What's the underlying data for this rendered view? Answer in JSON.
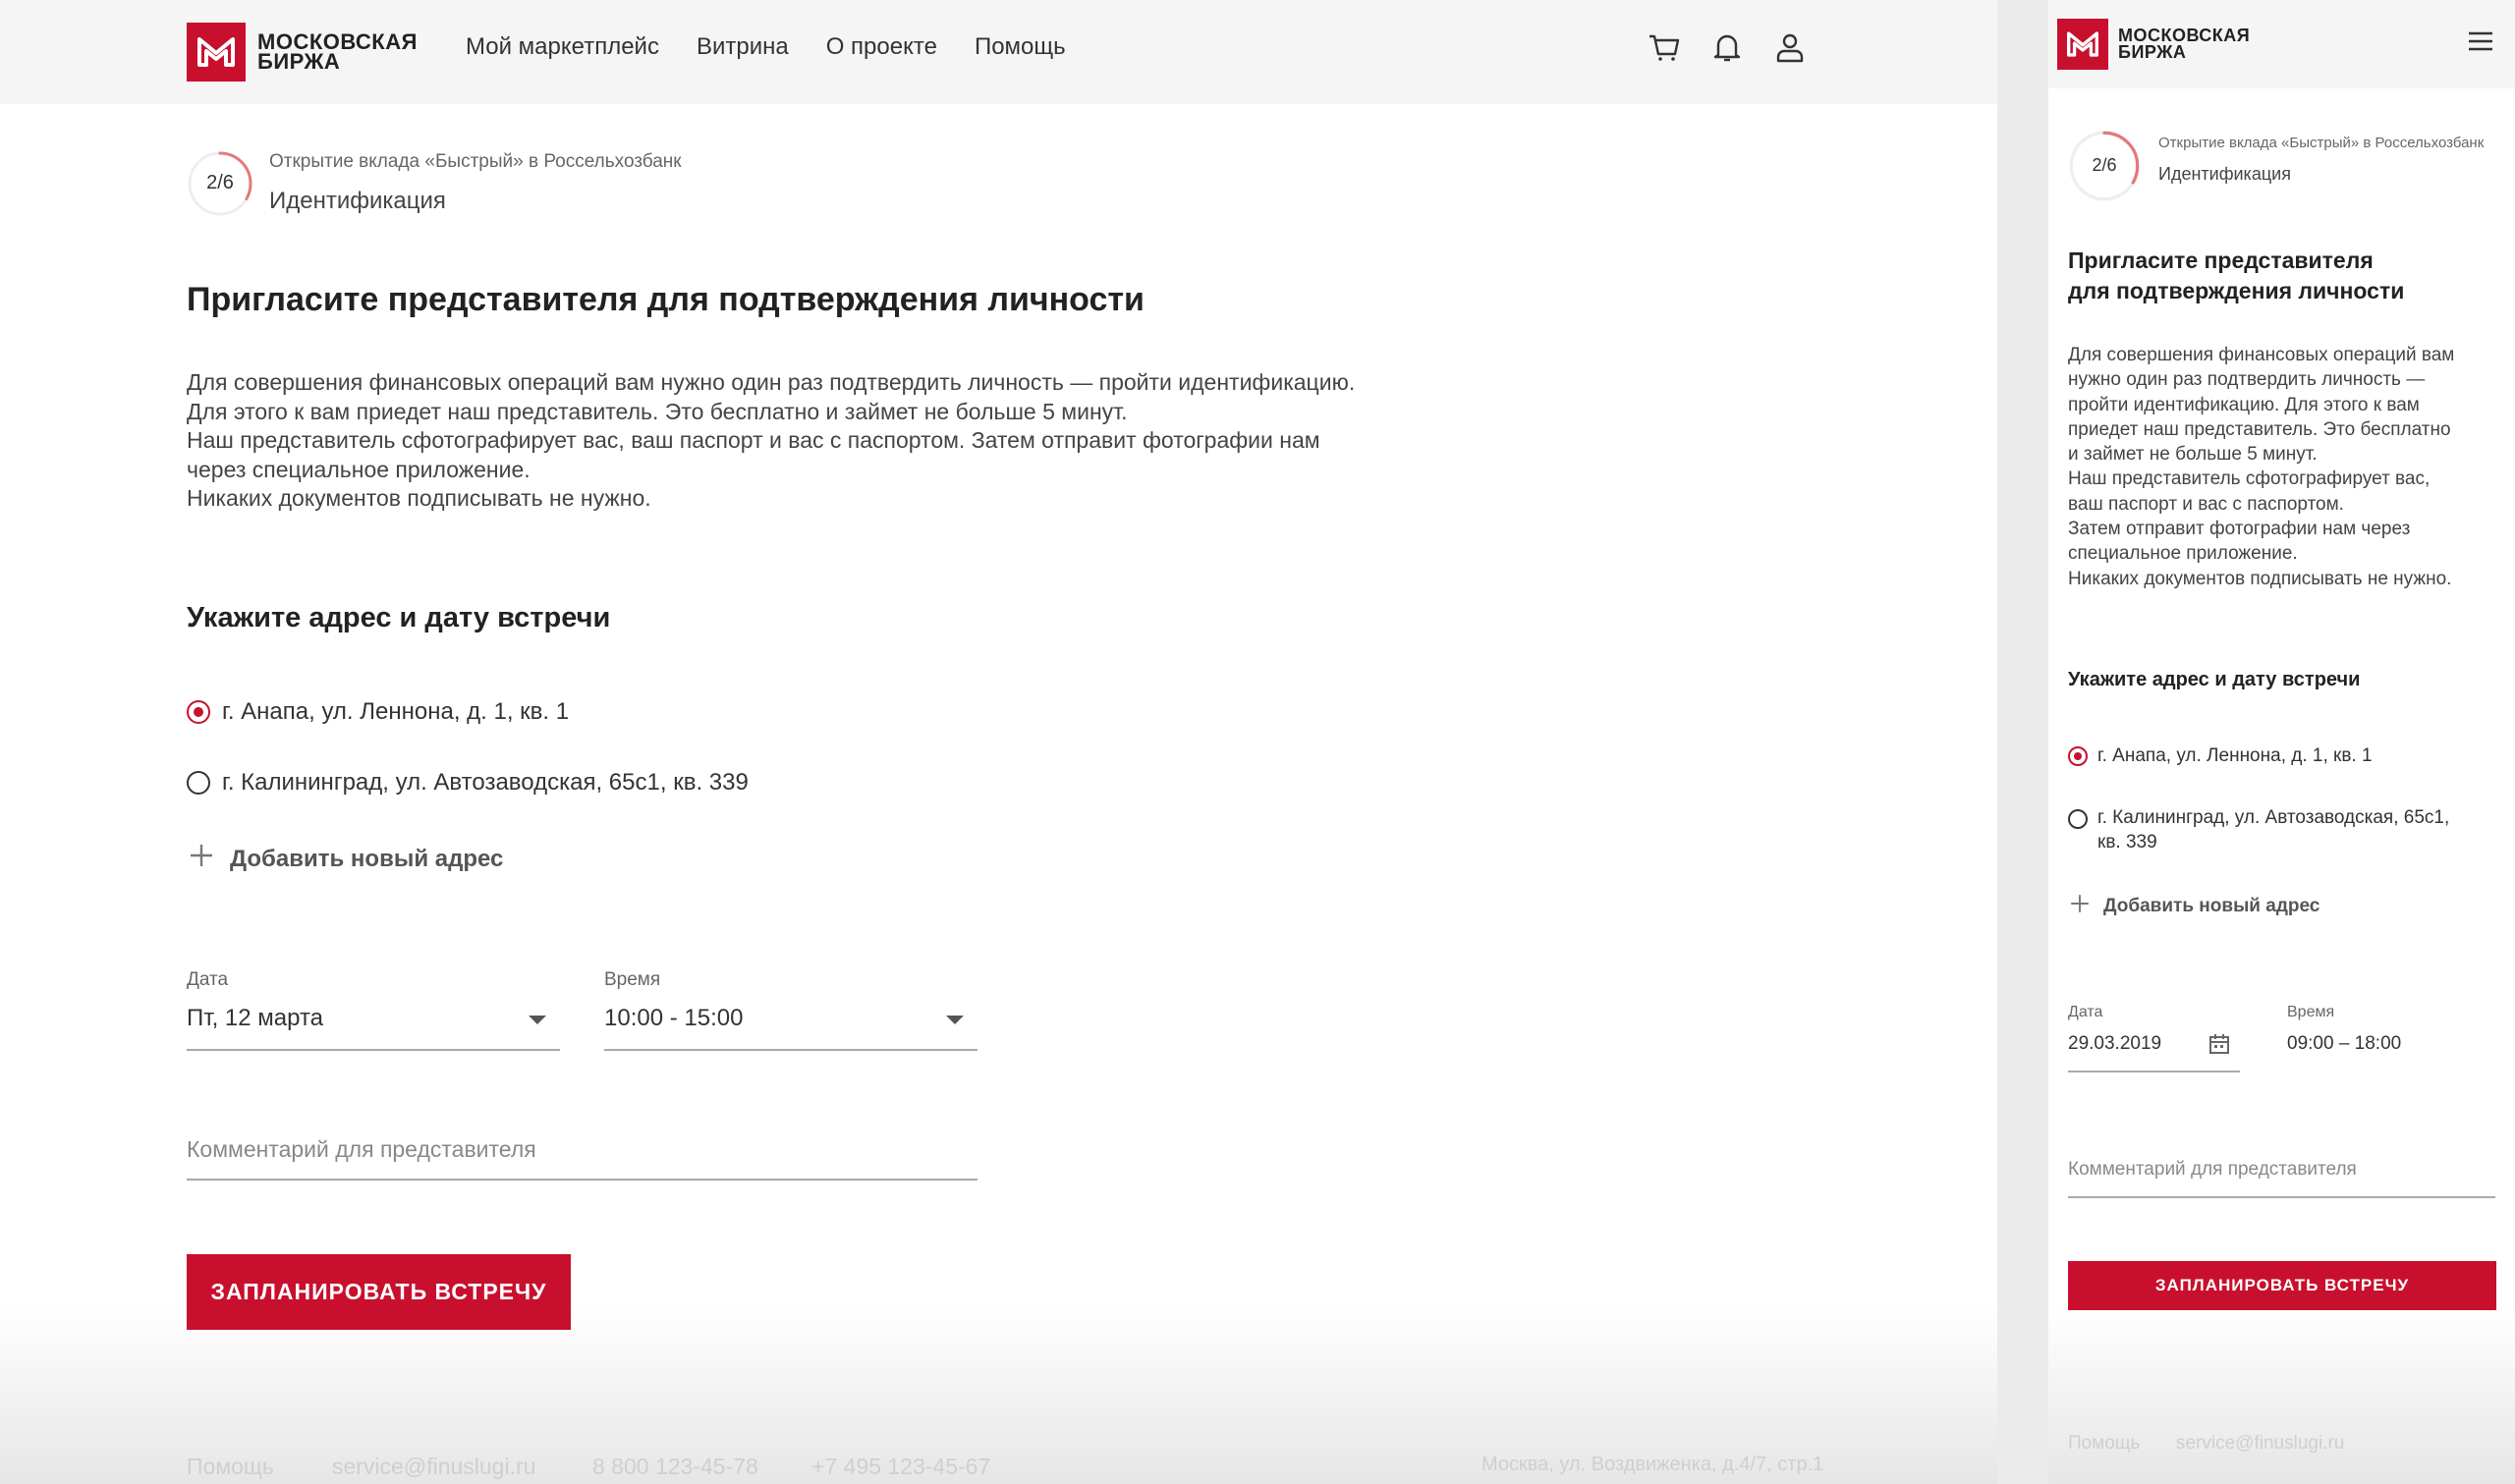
{
  "brand": {
    "line1": "Московская",
    "line2": "Биржа"
  },
  "nav": [
    "Мой маркетплейс",
    "Витрина",
    "О проекте",
    "Помощь"
  ],
  "icons": {
    "cart": "cart-icon",
    "bell": "bell-icon",
    "user": "user-icon",
    "menu": "menu-icon",
    "calendar": "calendar-icon",
    "chevron": "chevron-down-icon",
    "plus": "plus-icon"
  },
  "progress": {
    "label": "2/6",
    "value": 0.333
  },
  "crumb": {
    "title": "Открытие вклада «Быстрый» в Россельхозбанк",
    "step": "Идентификация"
  },
  "heading": "Пригласите представителя для подтверждения личности",
  "mobile_heading": [
    "Пригласите представителя",
    "для подтверждения личности"
  ],
  "intro": [
    "Для совершения финансовых операций вам нужно один раз подтвердить личность — пройти идентификацию.",
    "Для этого к вам приедет наш представитель. Это бесплатно и займет не больше 5 минут.",
    "Наш представитель сфотографирует вас, ваш паспорт и вас с паспортом. Затем отправит фотографии нам",
    "через специальное приложение.",
    "Никаких документов подписывать не нужно."
  ],
  "mobile_intro": [
    "Для совершения финансовых операций вам",
    "нужно один раз подтвердить личность —",
    "пройти идентификацию. Для этого к вам",
    "приедет наш представитель. Это бесплатно",
    "и займет не больше 5 минут.",
    "Наш представитель сфотографирует вас,",
    "ваш паспорт и вас с паспортом.",
    "Затем отправит фотографии нам через",
    "специальное приложение.",
    "Никаких документов подписывать не нужно."
  ],
  "address_heading": "Укажите адрес и дату встречи",
  "addresses": [
    {
      "text": "г. Анапа, ул. Леннона, д. 1, кв. 1",
      "checked": true
    },
    {
      "text": "г. Калининград, ул. Автозаводская, 65с1, кв. 339",
      "checked": false
    }
  ],
  "mobile_address2": [
    "г. Калининград, ул. Автозаводская, 65с1,",
    "кв. 339"
  ],
  "add_address": "Добавить новый адрес",
  "date": {
    "label": "Дата",
    "value": "Пт, 12 марта",
    "mobile_value": "29.03.2019"
  },
  "time": {
    "label": "Время",
    "value": "10:00 - 15:00",
    "mobile_value": "09:00 – 18:00"
  },
  "comment_placeholder": "Комментарий для представителя",
  "cta": "Запланировать встречу",
  "footer": {
    "help": "Помощь",
    "email": "service@finuslugi.ru",
    "phone1": "8 800 123-45-78",
    "phone2": "+7 495 123-45-67",
    "address": "Москва, ул. Воздвиженка, д.4/7, стр.1"
  },
  "colors": {
    "accent": "#c8102e",
    "header_bg": "#f5f5f5"
  }
}
